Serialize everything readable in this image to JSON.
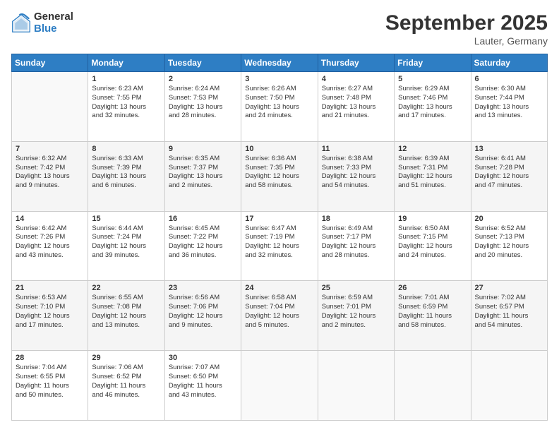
{
  "logo": {
    "general": "General",
    "blue": "Blue"
  },
  "title": "September 2025",
  "location": "Lauter, Germany",
  "headers": [
    "Sunday",
    "Monday",
    "Tuesday",
    "Wednesday",
    "Thursday",
    "Friday",
    "Saturday"
  ],
  "weeks": [
    [
      {
        "day": "",
        "info": ""
      },
      {
        "day": "1",
        "info": "Sunrise: 6:23 AM\nSunset: 7:55 PM\nDaylight: 13 hours\nand 32 minutes."
      },
      {
        "day": "2",
        "info": "Sunrise: 6:24 AM\nSunset: 7:53 PM\nDaylight: 13 hours\nand 28 minutes."
      },
      {
        "day": "3",
        "info": "Sunrise: 6:26 AM\nSunset: 7:50 PM\nDaylight: 13 hours\nand 24 minutes."
      },
      {
        "day": "4",
        "info": "Sunrise: 6:27 AM\nSunset: 7:48 PM\nDaylight: 13 hours\nand 21 minutes."
      },
      {
        "day": "5",
        "info": "Sunrise: 6:29 AM\nSunset: 7:46 PM\nDaylight: 13 hours\nand 17 minutes."
      },
      {
        "day": "6",
        "info": "Sunrise: 6:30 AM\nSunset: 7:44 PM\nDaylight: 13 hours\nand 13 minutes."
      }
    ],
    [
      {
        "day": "7",
        "info": "Sunrise: 6:32 AM\nSunset: 7:42 PM\nDaylight: 13 hours\nand 9 minutes."
      },
      {
        "day": "8",
        "info": "Sunrise: 6:33 AM\nSunset: 7:39 PM\nDaylight: 13 hours\nand 6 minutes."
      },
      {
        "day": "9",
        "info": "Sunrise: 6:35 AM\nSunset: 7:37 PM\nDaylight: 13 hours\nand 2 minutes."
      },
      {
        "day": "10",
        "info": "Sunrise: 6:36 AM\nSunset: 7:35 PM\nDaylight: 12 hours\nand 58 minutes."
      },
      {
        "day": "11",
        "info": "Sunrise: 6:38 AM\nSunset: 7:33 PM\nDaylight: 12 hours\nand 54 minutes."
      },
      {
        "day": "12",
        "info": "Sunrise: 6:39 AM\nSunset: 7:31 PM\nDaylight: 12 hours\nand 51 minutes."
      },
      {
        "day": "13",
        "info": "Sunrise: 6:41 AM\nSunset: 7:28 PM\nDaylight: 12 hours\nand 47 minutes."
      }
    ],
    [
      {
        "day": "14",
        "info": "Sunrise: 6:42 AM\nSunset: 7:26 PM\nDaylight: 12 hours\nand 43 minutes."
      },
      {
        "day": "15",
        "info": "Sunrise: 6:44 AM\nSunset: 7:24 PM\nDaylight: 12 hours\nand 39 minutes."
      },
      {
        "day": "16",
        "info": "Sunrise: 6:45 AM\nSunset: 7:22 PM\nDaylight: 12 hours\nand 36 minutes."
      },
      {
        "day": "17",
        "info": "Sunrise: 6:47 AM\nSunset: 7:19 PM\nDaylight: 12 hours\nand 32 minutes."
      },
      {
        "day": "18",
        "info": "Sunrise: 6:49 AM\nSunset: 7:17 PM\nDaylight: 12 hours\nand 28 minutes."
      },
      {
        "day": "19",
        "info": "Sunrise: 6:50 AM\nSunset: 7:15 PM\nDaylight: 12 hours\nand 24 minutes."
      },
      {
        "day": "20",
        "info": "Sunrise: 6:52 AM\nSunset: 7:13 PM\nDaylight: 12 hours\nand 20 minutes."
      }
    ],
    [
      {
        "day": "21",
        "info": "Sunrise: 6:53 AM\nSunset: 7:10 PM\nDaylight: 12 hours\nand 17 minutes."
      },
      {
        "day": "22",
        "info": "Sunrise: 6:55 AM\nSunset: 7:08 PM\nDaylight: 12 hours\nand 13 minutes."
      },
      {
        "day": "23",
        "info": "Sunrise: 6:56 AM\nSunset: 7:06 PM\nDaylight: 12 hours\nand 9 minutes."
      },
      {
        "day": "24",
        "info": "Sunrise: 6:58 AM\nSunset: 7:04 PM\nDaylight: 12 hours\nand 5 minutes."
      },
      {
        "day": "25",
        "info": "Sunrise: 6:59 AM\nSunset: 7:01 PM\nDaylight: 12 hours\nand 2 minutes."
      },
      {
        "day": "26",
        "info": "Sunrise: 7:01 AM\nSunset: 6:59 PM\nDaylight: 11 hours\nand 58 minutes."
      },
      {
        "day": "27",
        "info": "Sunrise: 7:02 AM\nSunset: 6:57 PM\nDaylight: 11 hours\nand 54 minutes."
      }
    ],
    [
      {
        "day": "28",
        "info": "Sunrise: 7:04 AM\nSunset: 6:55 PM\nDaylight: 11 hours\nand 50 minutes."
      },
      {
        "day": "29",
        "info": "Sunrise: 7:06 AM\nSunset: 6:52 PM\nDaylight: 11 hours\nand 46 minutes."
      },
      {
        "day": "30",
        "info": "Sunrise: 7:07 AM\nSunset: 6:50 PM\nDaylight: 11 hours\nand 43 minutes."
      },
      {
        "day": "",
        "info": ""
      },
      {
        "day": "",
        "info": ""
      },
      {
        "day": "",
        "info": ""
      },
      {
        "day": "",
        "info": ""
      }
    ]
  ]
}
